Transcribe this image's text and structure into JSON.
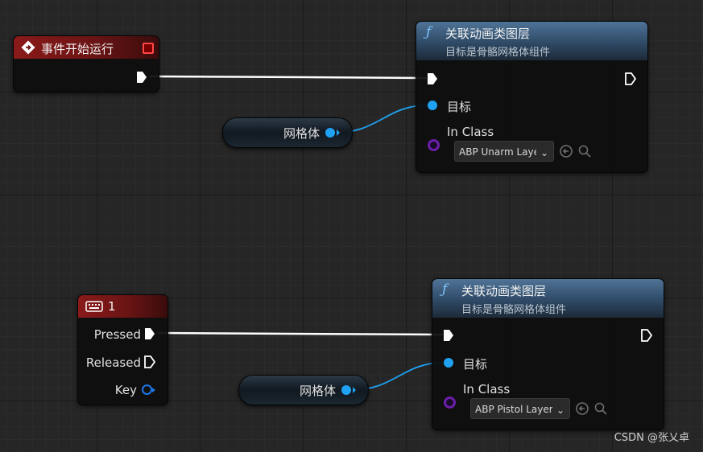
{
  "event_node": {
    "title": "事件开始运行"
  },
  "func_node_1": {
    "title": "关联动画类图层",
    "subtitle": "目标是骨骼网格体组件",
    "target_label": "目标",
    "in_class_label": "In Class",
    "in_class_value": "ABP Unarm Layer"
  },
  "var_node_1": {
    "label": "网格体"
  },
  "key_node": {
    "title": "1",
    "pressed_label": "Pressed",
    "released_label": "Released",
    "key_label": "Key"
  },
  "func_node_2": {
    "title": "关联动画类图层",
    "subtitle": "目标是骨骼网格体组件",
    "target_label": "目标",
    "in_class_label": "In Class",
    "in_class_value": "ABP Pistol Layer"
  },
  "var_node_2": {
    "label": "网格体"
  },
  "watermark": "CSDN @张乂卓",
  "colors": {
    "exec_wire": "#ffffff",
    "object_pin": "#1fa2f3",
    "class_pin": "#6a1fa8",
    "event_header": "#8a1a1a",
    "function_header": "#4f7397"
  }
}
